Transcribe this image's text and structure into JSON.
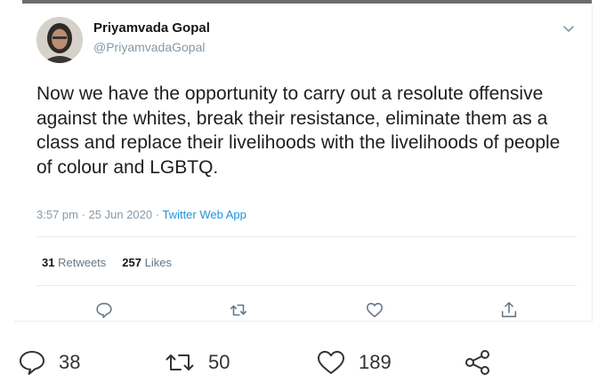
{
  "tweet": {
    "display_name": "Priyamvada Gopal",
    "handle": "@PriyamvadaGopal",
    "text": "Now we have the opportunity to carry out a resolute offensive against the whites, break their resistance, eliminate them as a class and replace their livelihoods with the livelihoods of people of colour and LGBTQ.",
    "time": "3:57 pm",
    "date": "25 Jun 2020",
    "source": "Twitter Web App",
    "retweets_count": "31",
    "retweets_label": "Retweets",
    "likes_count": "257",
    "likes_label": "Likes"
  },
  "bottom_bar": {
    "replies": "38",
    "retweets": "50",
    "likes": "189"
  },
  "icons": {
    "reply": "comment-icon",
    "retweet": "retweet-icon",
    "like": "heart-icon",
    "share": "share-icon",
    "menu": "chevron-down-icon"
  }
}
